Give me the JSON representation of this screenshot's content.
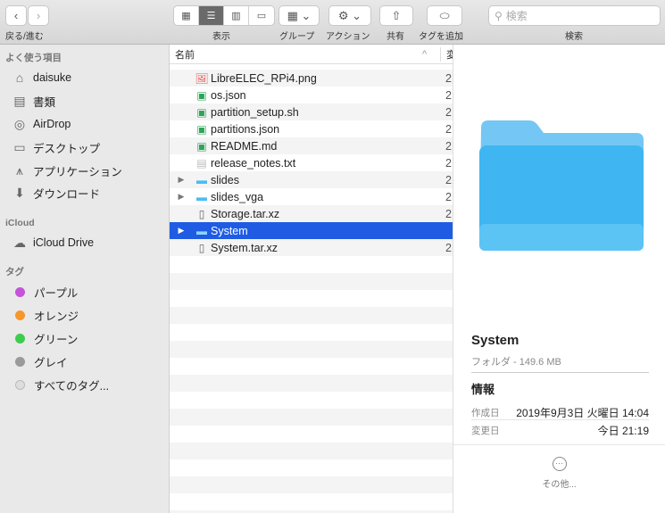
{
  "toolbar": {
    "nav_label": "戻る/進む",
    "view_label": "表示",
    "group_label": "グループ",
    "action_label": "アクション",
    "share_label": "共有",
    "tag_label": "タグを追加",
    "search_label": "検索",
    "search_placeholder": "検索"
  },
  "sidebar": {
    "favorites_heading": "よく使う項目",
    "favorites": [
      {
        "label": "daisuke",
        "icon": "home-icon"
      },
      {
        "label": "書類",
        "icon": "documents-icon"
      },
      {
        "label": "AirDrop",
        "icon": "airdrop-icon"
      },
      {
        "label": "デスクトップ",
        "icon": "desktop-icon"
      },
      {
        "label": "アプリケーション",
        "icon": "applications-icon"
      },
      {
        "label": "ダウンロード",
        "icon": "download-icon"
      }
    ],
    "icloud_heading": "iCloud",
    "icloud_drive": "iCloud Drive",
    "tags_heading": "タグ",
    "tags": [
      {
        "label": "パープル",
        "color": "#c453d8"
      },
      {
        "label": "オレンジ",
        "color": "#f7962a"
      },
      {
        "label": "グリーン",
        "color": "#3ccd4e"
      },
      {
        "label": "グレイ",
        "color": "#9a9a9a"
      },
      {
        "label": "すべてのタグ...",
        "color": ""
      }
    ]
  },
  "list": {
    "col_name": "名前",
    "col_date": "変",
    "sort_indicator": "^",
    "rows": [
      {
        "name": "LibreELEC_RPi4.png",
        "date": "2",
        "type": "image"
      },
      {
        "name": "os.json",
        "date": "2",
        "type": "code"
      },
      {
        "name": "partition_setup.sh",
        "date": "2",
        "type": "code"
      },
      {
        "name": "partitions.json",
        "date": "2",
        "type": "code"
      },
      {
        "name": "README.md",
        "date": "2",
        "type": "code"
      },
      {
        "name": "release_notes.txt",
        "date": "2",
        "type": "text"
      },
      {
        "name": "slides",
        "date": "2",
        "type": "folder"
      },
      {
        "name": "slides_vga",
        "date": "2",
        "type": "folder"
      },
      {
        "name": "Storage.tar.xz",
        "date": "2",
        "type": "archive"
      },
      {
        "name": "System",
        "date": "",
        "type": "folder",
        "selected": true
      },
      {
        "name": "System.tar.xz",
        "date": "2",
        "type": "archive"
      }
    ]
  },
  "preview": {
    "title": "System",
    "subtitle": "フォルダ - 149.6 MB",
    "info_heading": "情報",
    "created_label": "作成日",
    "created_value": "2019年9月3日 火曜日 14:04",
    "modified_label": "変更日",
    "modified_value": "今日 21:19",
    "more_label": "その他..."
  }
}
